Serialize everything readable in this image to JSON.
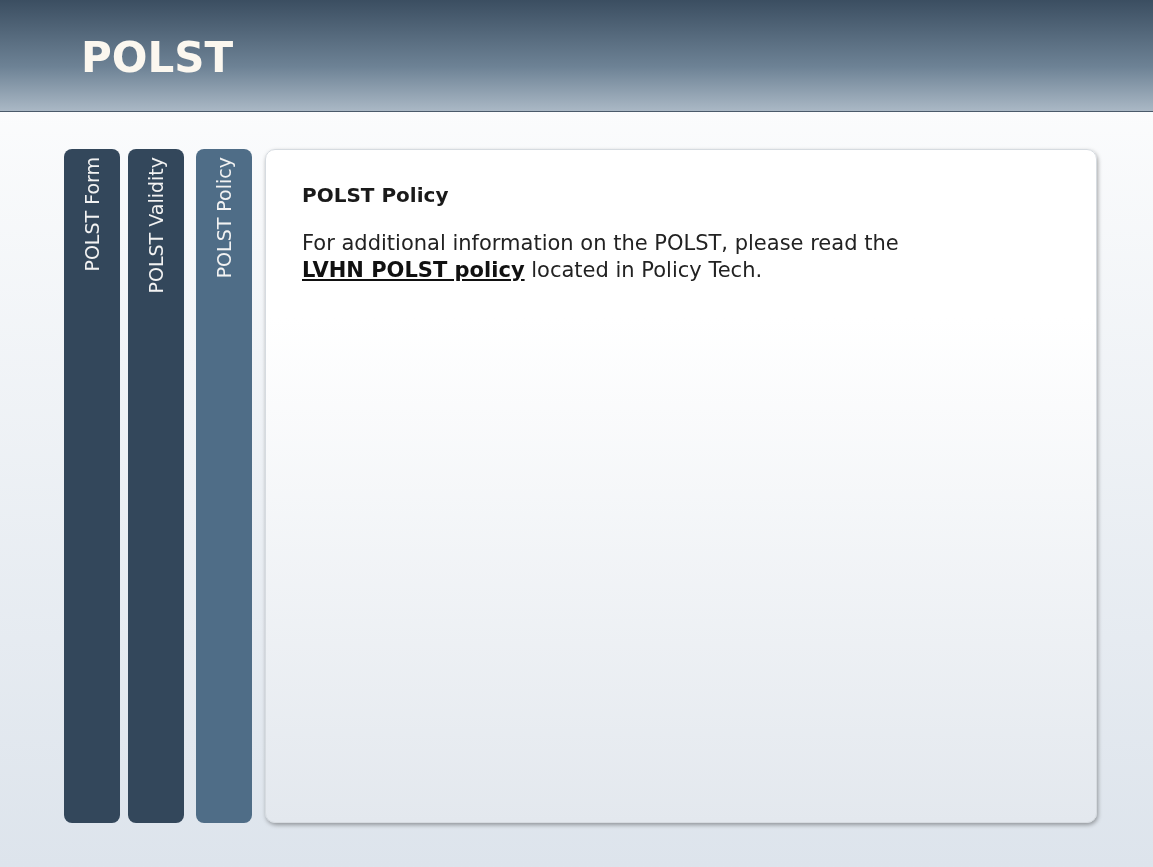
{
  "header": {
    "title": "POLST"
  },
  "tabs": [
    {
      "label": "POLST Form",
      "selected": false
    },
    {
      "label": "POLST Validity",
      "selected": false
    },
    {
      "label": "POLST Policy",
      "selected": true
    }
  ],
  "content": {
    "heading": "POLST Policy",
    "text_before": "For additional information on the POLST, please read the",
    "link": "LVHN POLST policy",
    "text_after": "located in Policy Tech."
  }
}
